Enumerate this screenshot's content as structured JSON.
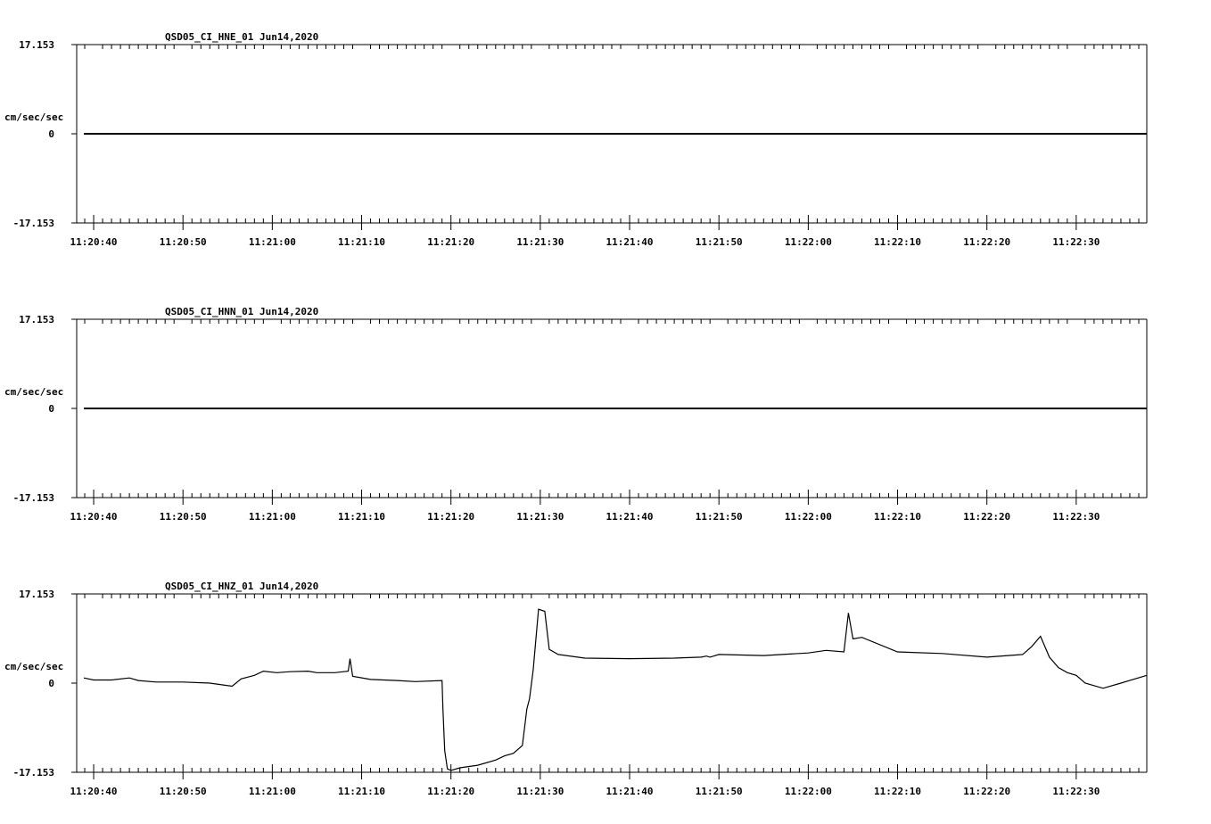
{
  "colors": {
    "trace": "#000000",
    "axes": "#000000",
    "background": "#ffffff"
  },
  "chart_data": [
    {
      "type": "line",
      "title": "QSD05_CI_HNE_01  Jun14,2020",
      "ylabel": "cm/sec/sec",
      "ylim": [
        -17.153,
        17.153
      ],
      "y_tick_labels": [
        "17.153",
        "0",
        "-17.153"
      ],
      "x_tick_labels": [
        "11:20:40",
        "11:20:50",
        "11:21:00",
        "11:21:10",
        "11:21:20",
        "11:21:30",
        "11:21:40",
        "11:21:50",
        "11:22:00",
        "11:22:10",
        "11:22:20",
        "11:22:30"
      ],
      "x_range_seconds": [
        38.1,
        157.9
      ],
      "series": [
        {
          "x": [
            38.9,
            157.9
          ],
          "y": [
            0,
            0
          ]
        }
      ]
    },
    {
      "type": "line",
      "title": "QSD05_CI_HNN_01  Jun14,2020",
      "ylabel": "cm/sec/sec",
      "ylim": [
        -17.153,
        17.153
      ],
      "y_tick_labels": [
        "17.153",
        "0",
        "-17.153"
      ],
      "x_tick_labels": [
        "11:20:40",
        "11:20:50",
        "11:21:00",
        "11:21:10",
        "11:21:20",
        "11:21:30",
        "11:21:40",
        "11:21:50",
        "11:22:00",
        "11:22:10",
        "11:22:20",
        "11:22:30"
      ],
      "x_range_seconds": [
        38.1,
        157.9
      ],
      "series": [
        {
          "x": [
            38.9,
            157.9
          ],
          "y": [
            0,
            0
          ]
        }
      ]
    },
    {
      "type": "line",
      "title": "QSD05_CI_HNZ_01  Jun14,2020",
      "ylabel": "cm/sec/sec",
      "ylim": [
        -17.153,
        17.153
      ],
      "y_tick_labels": [
        "17.153",
        "0",
        "-17.153"
      ],
      "x_tick_labels": [
        "11:20:40",
        "11:20:50",
        "11:21:00",
        "11:21:10",
        "11:21:20",
        "11:21:30",
        "11:21:40",
        "11:21:50",
        "11:22:00",
        "11:22:10",
        "11:22:20",
        "11:22:30"
      ],
      "x_range_seconds": [
        38.1,
        157.9
      ],
      "series": [
        {
          "x": [
            38.9,
            40.0,
            42.0,
            44.0,
            45.0,
            47.0,
            50.0,
            53.0,
            55.5,
            56.5,
            58.0,
            59.0,
            60.5,
            62.0,
            64.0,
            65.0,
            67.0,
            68.5,
            68.7,
            69.0,
            71.0,
            74.0,
            76.0,
            79.0,
            79.1,
            79.3,
            79.6,
            80.0,
            81.0,
            83.0,
            85.0,
            86.0,
            87.0,
            88.0,
            88.5,
            88.8,
            89.2,
            89.8,
            90.5,
            91.0,
            92.0,
            95.0,
            100.0,
            105.0,
            108.0,
            108.6,
            109.0,
            110.0,
            115.0,
            120.0,
            122.0,
            124.0,
            124.5,
            125.0,
            126.0,
            130.0,
            135.0,
            140.0,
            144.0,
            145.0,
            146.0,
            147.0,
            148.0,
            149.0,
            150.0,
            151.0,
            153.0,
            155.0,
            157.9
          ],
          "y": [
            1.0,
            0.6,
            0.6,
            1.0,
            0.5,
            0.2,
            0.2,
            0.0,
            -0.6,
            0.8,
            1.5,
            2.3,
            2.0,
            2.2,
            2.3,
            2.0,
            2.0,
            2.3,
            4.7,
            1.3,
            0.7,
            0.5,
            0.3,
            0.5,
            -5.0,
            -13.0,
            -16.5,
            -16.8,
            -16.3,
            -15.8,
            -14.8,
            -14.0,
            -13.5,
            -12.0,
            -5.0,
            -3.0,
            2.5,
            14.2,
            13.8,
            6.5,
            5.5,
            4.8,
            4.7,
            4.8,
            5.0,
            5.2,
            5.0,
            5.5,
            5.3,
            5.8,
            6.3,
            6.0,
            13.5,
            8.5,
            8.8,
            6.0,
            5.7,
            5.0,
            5.5,
            7.0,
            9.0,
            5.0,
            3.0,
            2.0,
            1.5,
            0.0,
            -1.0,
            0.0,
            1.5
          ]
        }
      ]
    }
  ]
}
